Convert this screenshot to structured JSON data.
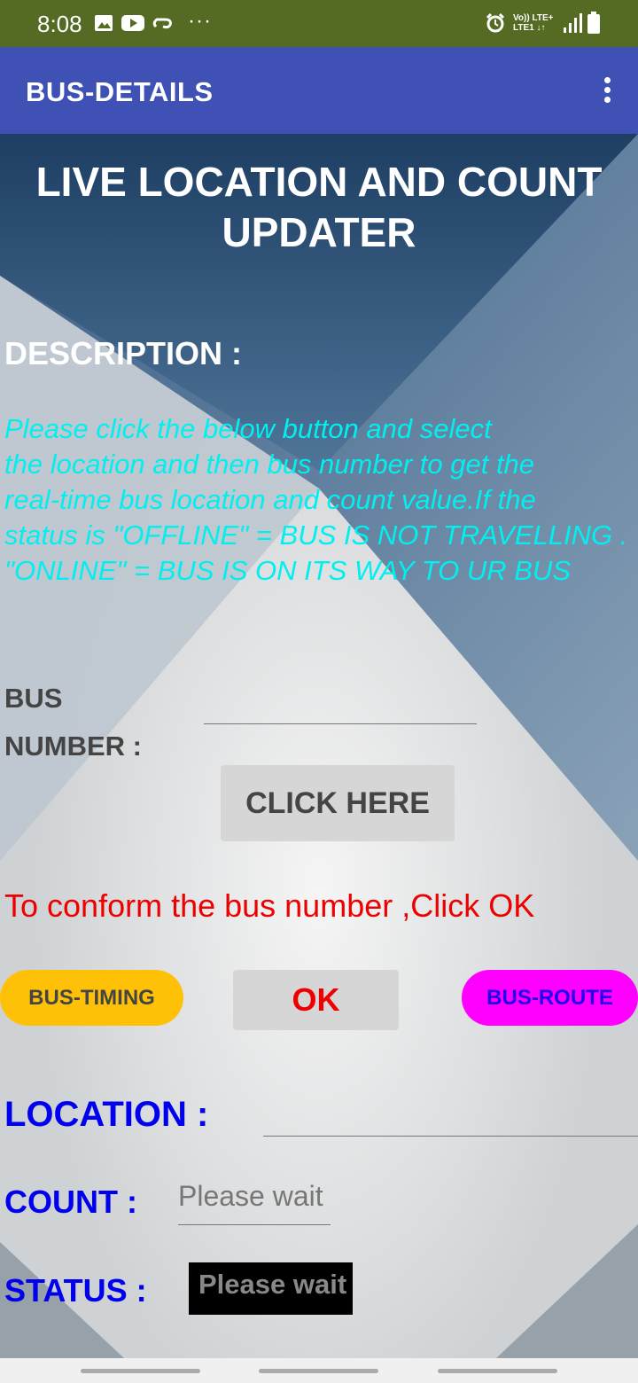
{
  "status_bar": {
    "time": "8:08",
    "overflow": "···",
    "icons": [
      "image-icon",
      "youtube-icon",
      "link-icon",
      "alarm-icon",
      "volte-icon",
      "signal-icon",
      "battery-icon"
    ],
    "volte_text": "Vo)) LTE+",
    "lte_text": "LTE1 ↓↑"
  },
  "app_bar": {
    "title": "BUS-DETAILS",
    "menu_icon": "overflow-menu-icon"
  },
  "main": {
    "heading": "LIVE LOCATION AND COUNT UPDATER",
    "description_label": "DESCRIPTION :",
    "description_text": "Please click the below button and select\nthe location and then bus number to get the\nreal-time bus location and count value.If the\nstatus is \"OFFLINE\" = BUS IS NOT TRAVELLING .\n\"ONLINE\" = BUS IS ON ITS WAY TO UR BUS",
    "bus_number_label": "BUS NUMBER :",
    "click_here_label": "CLICK HERE",
    "confirm_text": "To conform the bus number ,Click OK",
    "bus_timing_label": "BUS-TIMING",
    "ok_label": "OK",
    "bus_route_label": "BUS-ROUTE",
    "location_label": "LOCATION :",
    "count_label": "COUNT :",
    "count_value": "Please wait",
    "status_label": "STATUS :",
    "status_value": "Please wait"
  },
  "colors": {
    "status_bar": "#556b24",
    "app_bar": "#3f51b5",
    "description": "#00f0f0",
    "confirm": "#ee0000",
    "labels": "#0000ee",
    "bus_timing": "#ffc107",
    "bus_route": "#ff00ff"
  }
}
